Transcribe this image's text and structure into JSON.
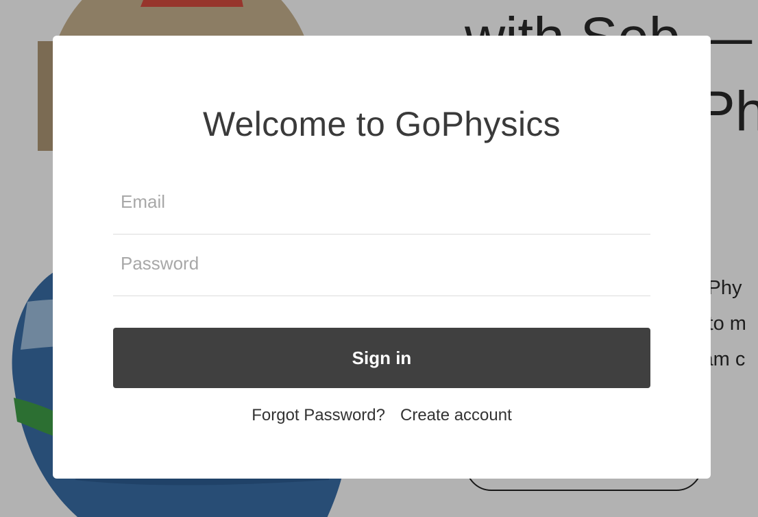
{
  "background": {
    "heading_line1": "with Seb —",
    "heading_line2": "Phy",
    "body_lines": [
      "s Phy",
      "s to m",
      "xam c"
    ]
  },
  "modal": {
    "title": "Welcome to GoPhysics",
    "email": {
      "placeholder": "Email",
      "value": ""
    },
    "password": {
      "placeholder": "Password",
      "value": ""
    },
    "signin_label": "Sign in",
    "forgot_label": "Forgot Password?",
    "create_label": "Create account"
  },
  "colors": {
    "button_bg": "#404040",
    "title_text": "#3a3a3a",
    "placeholder": "#a8a8a8",
    "overlay": "rgba(0,0,0,0.30)"
  }
}
